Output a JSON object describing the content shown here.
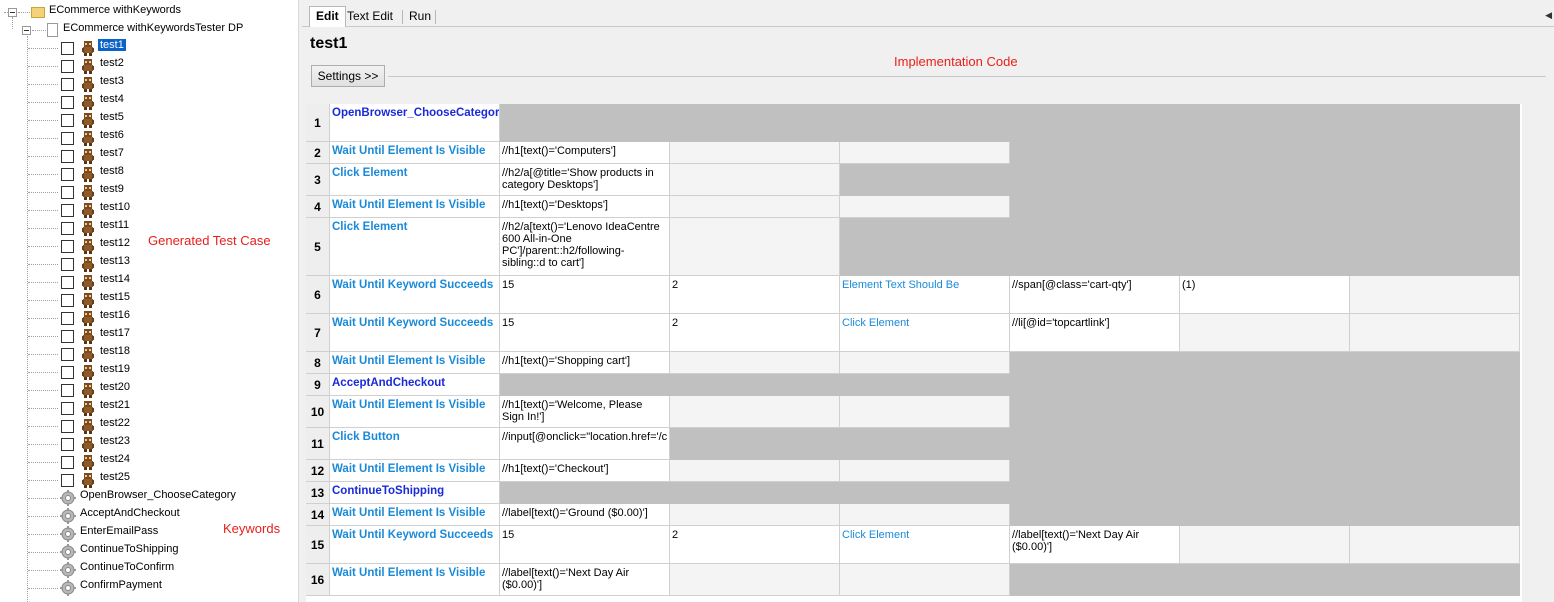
{
  "tree": {
    "root_label": "ECommerce withKeywords",
    "suite_label": "ECommerce withKeywordsTester DP",
    "tests": [
      "test1",
      "test2",
      "test3",
      "test4",
      "test5",
      "test6",
      "test7",
      "test8",
      "test9",
      "test10",
      "test11",
      "test12",
      "test13",
      "test14",
      "test15",
      "test16",
      "test17",
      "test18",
      "test19",
      "test20",
      "test21",
      "test22",
      "test23",
      "test24",
      "test25"
    ],
    "selected_test": "test1",
    "keywords": [
      "OpenBrowser_ChooseCategory",
      "AcceptAndCheckout",
      "EnterEmailPass",
      "ContinueToShipping",
      "ContinueToConfirm",
      "ConfirmPayment"
    ]
  },
  "annotations": {
    "generated": "Generated Test Case",
    "keywords": "Keywords",
    "implementation": "Implementation Code"
  },
  "tabs": [
    {
      "label": "Edit",
      "active": true
    },
    {
      "label": "Text Edit",
      "active": false
    },
    {
      "label": "Run",
      "active": false
    }
  ],
  "editor": {
    "title": "test1",
    "settings_label": "Settings >>"
  },
  "rows": [
    {
      "num": "1",
      "cells": [
        "OpenBrowser_ChooseCategor"
      ],
      "user": true
    },
    {
      "num": "2",
      "cells": [
        "Wait Until Element Is Visible",
        "//h1[text()='Computers']"
      ]
    },
    {
      "num": "3",
      "cells": [
        "Click Element",
        "//h2/a[@title='Show products in category Desktops']"
      ]
    },
    {
      "num": "4",
      "cells": [
        "Wait Until Element Is Visible",
        "//h1[text()='Desktops']"
      ]
    },
    {
      "num": "5",
      "cells": [
        "Click Element",
        "//h2/a[text()='Lenovo IdeaCentre 600 All-in-One PC']/parent::h2/following-sibling::d to cart']"
      ]
    },
    {
      "num": "6",
      "cells": [
        "Wait Until Keyword Succeeds",
        "15",
        "2",
        "Element Text Should Be",
        "//span[@class='cart-qty']",
        "(1)"
      ]
    },
    {
      "num": "7",
      "cells": [
        "Wait Until Keyword Succeeds",
        "15",
        "2",
        "Click Element",
        "//li[@id='topcartlink']"
      ]
    },
    {
      "num": "8",
      "cells": [
        "Wait Until Element Is Visible",
        "//h1[text()='Shopping cart']"
      ]
    },
    {
      "num": "9",
      "cells": [
        "AcceptAndCheckout"
      ],
      "user": true
    },
    {
      "num": "10",
      "cells": [
        "Wait Until Element Is Visible",
        "//h1[text()='Welcome, Please Sign In!']"
      ]
    },
    {
      "num": "11",
      "cells": [
        "Click Button",
        "//input[@onclick=\"location.href='/c"
      ]
    },
    {
      "num": "12",
      "cells": [
        "Wait Until Element Is Visible",
        "//h1[text()='Checkout']"
      ]
    },
    {
      "num": "13",
      "cells": [
        "ContinueToShipping"
      ],
      "user": true
    },
    {
      "num": "14",
      "cells": [
        "Wait Until Element Is Visible",
        "//label[text()='Ground ($0.00)']"
      ]
    },
    {
      "num": "15",
      "cells": [
        "Wait Until Keyword Succeeds",
        "15",
        "2",
        "Click Element",
        "//label[text()='Next Day Air ($0.00)']"
      ]
    },
    {
      "num": "16",
      "cells": [
        "Wait Until Element Is Visible",
        "//label[text()='Next Day Air ($0.00)']"
      ]
    }
  ],
  "colors": {
    "selection": "#0a64c8",
    "keyword": "#1a8ad8",
    "user_keyword": "#1a2ad8",
    "annotation": "#e8201c",
    "gray_cell": "#c0c0c0"
  }
}
